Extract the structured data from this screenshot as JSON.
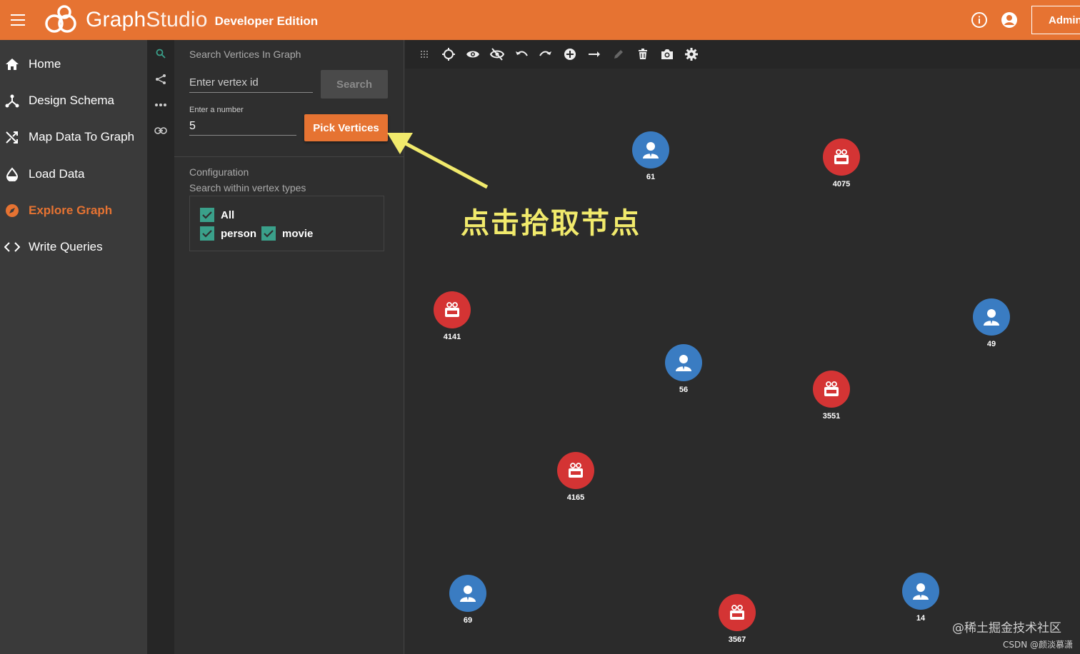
{
  "header": {
    "brand_main": "Graph",
    "brand_light": "Studio",
    "edition": "Developer Edition",
    "admin_label": "Admin"
  },
  "sidenav": {
    "items": [
      {
        "label": "Home",
        "icon": "home-icon"
      },
      {
        "label": "Design Schema",
        "icon": "schema-icon"
      },
      {
        "label": "Map Data To Graph",
        "icon": "shuffle-icon"
      },
      {
        "label": "Load Data",
        "icon": "drop-icon"
      },
      {
        "label": "Explore Graph",
        "icon": "compass-icon",
        "active": true
      },
      {
        "label": "Write Queries",
        "icon": "code-icon"
      }
    ]
  },
  "panel": {
    "title": "Search Vertices In Graph",
    "vertex_placeholder": "Enter vertex id",
    "search_label": "Search",
    "number_label": "Enter a number",
    "number_value": "5",
    "pick_label": "Pick Vertices",
    "config_title": "Configuration",
    "config_subtitle": "Search within vertex types",
    "types": [
      {
        "label": "All",
        "checked": true
      },
      {
        "label": "person",
        "checked": true
      },
      {
        "label": "movie",
        "checked": true
      }
    ]
  },
  "canvas": {
    "annotation": "点击拾取节点",
    "vertices": [
      {
        "id": "61",
        "type": "person"
      },
      {
        "id": "4075",
        "type": "movie"
      },
      {
        "id": "4141",
        "type": "movie"
      },
      {
        "id": "49",
        "type": "person"
      },
      {
        "id": "56",
        "type": "person"
      },
      {
        "id": "3551",
        "type": "movie"
      },
      {
        "id": "4165",
        "type": "movie"
      },
      {
        "id": "69",
        "type": "person"
      },
      {
        "id": "14",
        "type": "person"
      },
      {
        "id": "3567",
        "type": "movie"
      }
    ]
  },
  "watermark": {
    "main": "@稀土掘金技术社区",
    "sub": "CSDN @颜淡慕潇"
  },
  "colors": {
    "accent": "#e67332",
    "person": "#3a7cc2",
    "movie": "#d43434",
    "checkbox": "#3aa08a",
    "annotation": "#f1ea6c"
  }
}
